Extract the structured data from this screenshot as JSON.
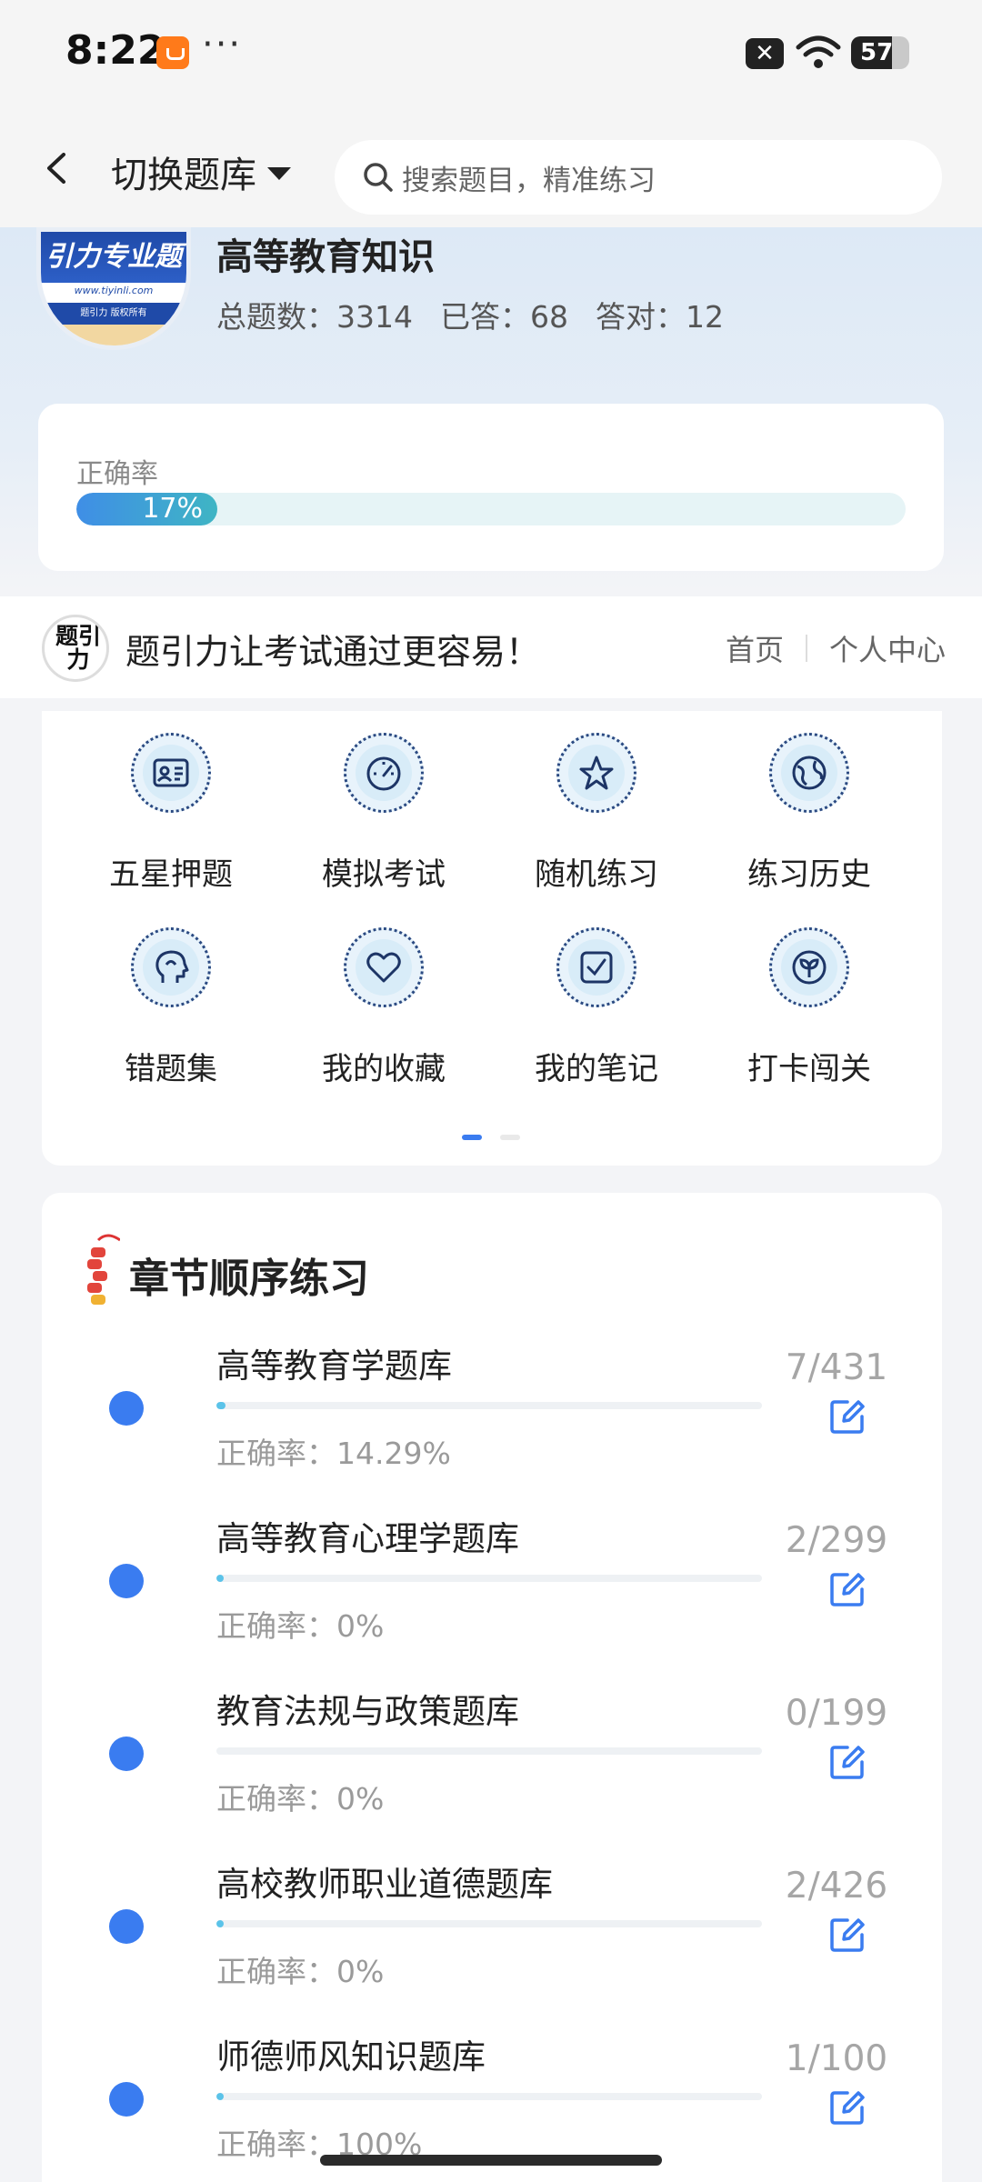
{
  "status_bar": {
    "time": "8:22",
    "more": "···",
    "battery": "57"
  },
  "nav": {
    "switch_label": "切换题库",
    "search_placeholder": "搜索题目，精准练习"
  },
  "book": {
    "logo_text": "引力专业题",
    "logo_url": "www.tiyinli.com",
    "logo_band": "题引力 版权所有",
    "title": "高等教育知识",
    "total": "总题数：3314",
    "answered": "已答：68",
    "correct": "答对：12"
  },
  "rate": {
    "label": "正确率",
    "value": 17,
    "text": "17%"
  },
  "slogan": {
    "logo_text": "题引力",
    "text": "题引力让考试通过更容易！",
    "home": "首页",
    "personal": "个人中心"
  },
  "features": [
    {
      "label": "五星押题",
      "icon": "id-card-icon"
    },
    {
      "label": "模拟考试",
      "icon": "speedometer-icon"
    },
    {
      "label": "随机练习",
      "icon": "shuffle-star-icon"
    },
    {
      "label": "练习历史",
      "icon": "globe-icon"
    },
    {
      "label": "错题集",
      "icon": "head-icon"
    },
    {
      "label": "我的收藏",
      "icon": "heart-icon"
    },
    {
      "label": "我的笔记",
      "icon": "checkbox-icon"
    },
    {
      "label": "打卡闯关",
      "icon": "sprout-icon"
    }
  ],
  "chapters": {
    "title": "章节顺序练习",
    "items": [
      {
        "name": "高等教育学题库",
        "rate": "正确率：14.29%",
        "count": "7/431",
        "progress": 0.016
      },
      {
        "name": "高等教育心理学题库",
        "rate": "正确率：0%",
        "count": "2/299",
        "progress": 0.007
      },
      {
        "name": "教育法规与政策题库",
        "rate": "正确率：0%",
        "count": "0/199",
        "progress": 0
      },
      {
        "name": "高校教师职业道德题库",
        "rate": "正确率：0%",
        "count": "2/426",
        "progress": 0.005
      },
      {
        "name": "师德师风知识题库",
        "rate": "正确率：100%",
        "count": "1/100",
        "progress": 0.01
      }
    ]
  },
  "colors": {
    "accent": "#3a7cf0",
    "rate_fill": "#3f8ee6",
    "chapter_fill": "#5bc3e9"
  }
}
